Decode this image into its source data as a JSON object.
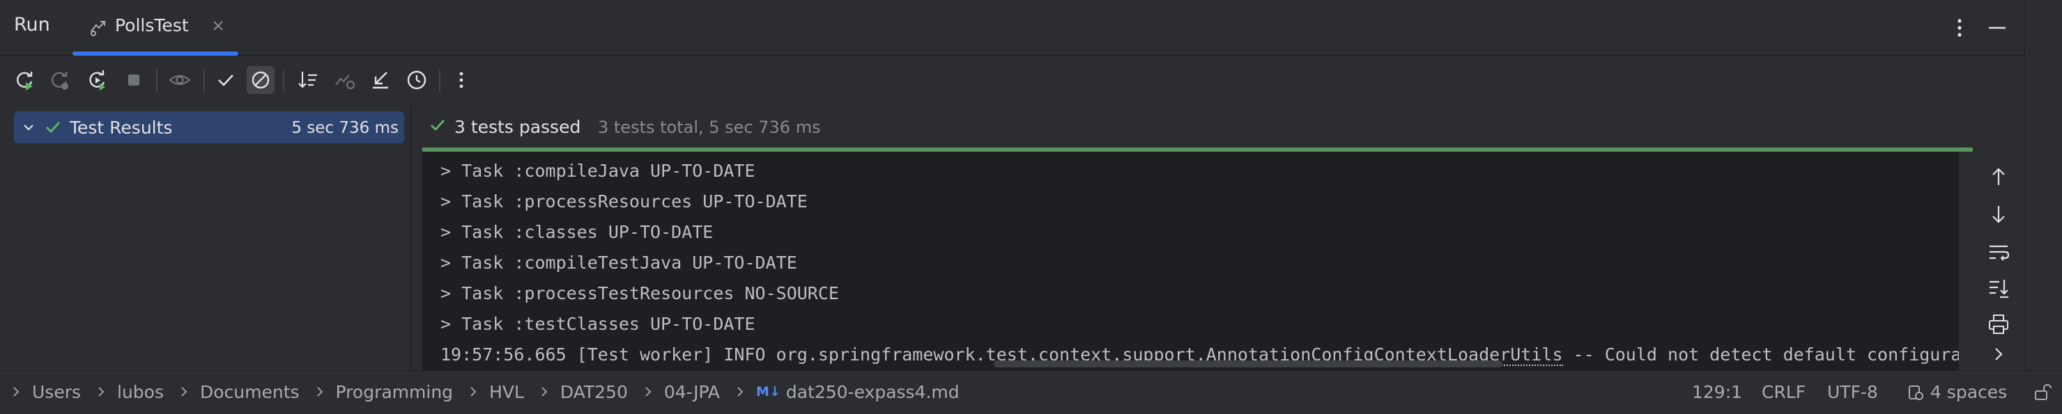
{
  "header": {
    "title": "Run",
    "tab_label": "PollsTest",
    "accent": "#3574f0"
  },
  "toolbar": {
    "buttons": [
      "rerun-icon",
      "rerun-failed-icon",
      "toggle-auto-test-icon",
      "stop-icon",
      "show-ignored-icon",
      "show-passed-icon",
      "show-ignored-toggle-icon",
      "sort-icon",
      "import-tests-icon",
      "collapse-icon",
      "history-icon",
      "more-icon"
    ]
  },
  "tree": {
    "root_label": "Test Results",
    "root_duration": "5 sec 736 ms"
  },
  "console": {
    "status": "3 tests passed",
    "summary": "3 tests total, 5 sec 736 ms",
    "pass_color": "#57965c",
    "lines": [
      "> Task :compileJava UP-TO-DATE",
      "> Task :processResources UP-TO-DATE",
      "> Task :classes UP-TO-DATE",
      "> Task :compileTestJava UP-TO-DATE",
      "> Task :processTestResources NO-SOURCE",
      "> Task :testClasses UP-TO-DATE"
    ],
    "last_line_prefix": "19:57:56.665 [Test worker] INFO org.springframework.test.context.support.",
    "last_line_link": "AnnotationConfigContextLoaderUtils",
    "last_line_suffix": " -- Could not detect default configuration classes"
  },
  "status_bar": {
    "breadcrumbs": [
      "Users",
      "lubos",
      "Documents",
      "Programming",
      "HVL",
      "DAT250",
      "04-JPA"
    ],
    "file_badge": "M↓",
    "file": "dat250-expass4.md",
    "position": "129:1",
    "line_sep": "CRLF",
    "encoding": "UTF-8",
    "indent": "4 spaces"
  }
}
